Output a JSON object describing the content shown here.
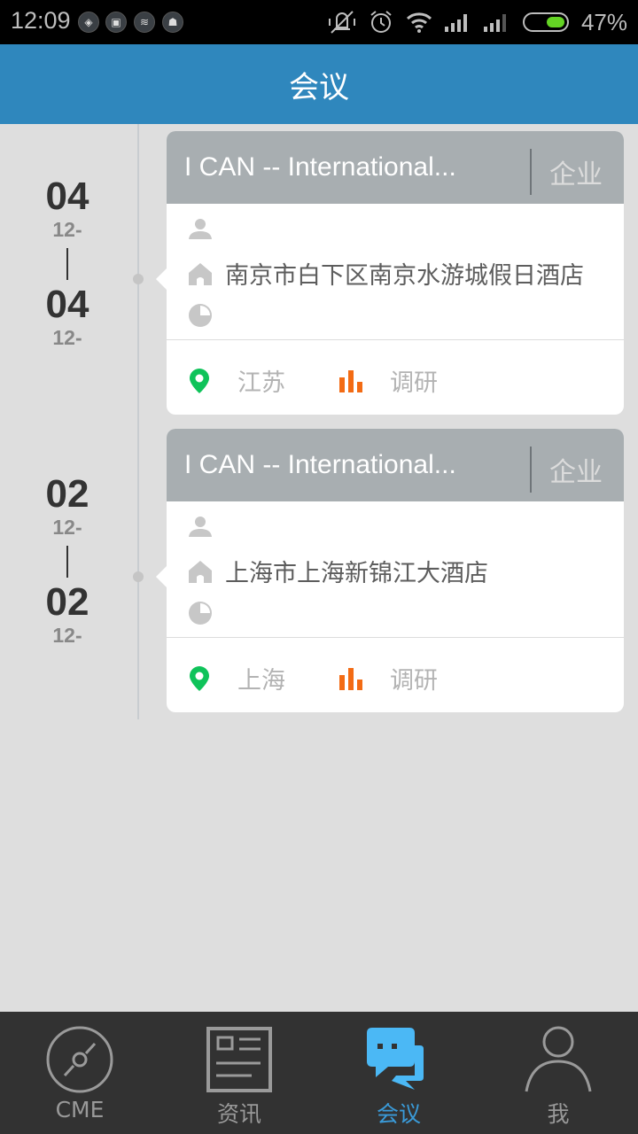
{
  "status_bar": {
    "time": "12:09",
    "battery_percent_label": "47%",
    "battery_level": 0.47,
    "notification_icons": [
      "shield-app-icon",
      "app-icon",
      "news-app-icon",
      "game-app-icon"
    ],
    "battery_fill_color": "#64d424"
  },
  "header": {
    "title": "会议",
    "background_color": "#2f87bd"
  },
  "meetings": [
    {
      "start_day": "04",
      "start_month": "12-",
      "end_day": "04",
      "end_month": "12-",
      "title": "I CAN -- International...",
      "type": "企业",
      "organizer": "",
      "venue": "南京市白下区南京水游城假日酒店",
      "time": "",
      "province": "江苏",
      "category": "调研"
    },
    {
      "start_day": "02",
      "start_month": "12-",
      "end_day": "02",
      "end_month": "12-",
      "title": "I CAN -- International...",
      "type": "企业",
      "organizer": "",
      "venue": "上海市上海新锦江大酒店",
      "time": "",
      "province": "上海",
      "category": "调研"
    }
  ],
  "bottom_nav": {
    "active_index": 2,
    "active_color": "#3a9ad8",
    "items": [
      {
        "label": "CME",
        "icon": "disc-icon"
      },
      {
        "label": "资讯",
        "icon": "news-icon"
      },
      {
        "label": "会议",
        "icon": "chat-bubbles-icon"
      },
      {
        "label": "我",
        "icon": "person-icon"
      }
    ]
  }
}
